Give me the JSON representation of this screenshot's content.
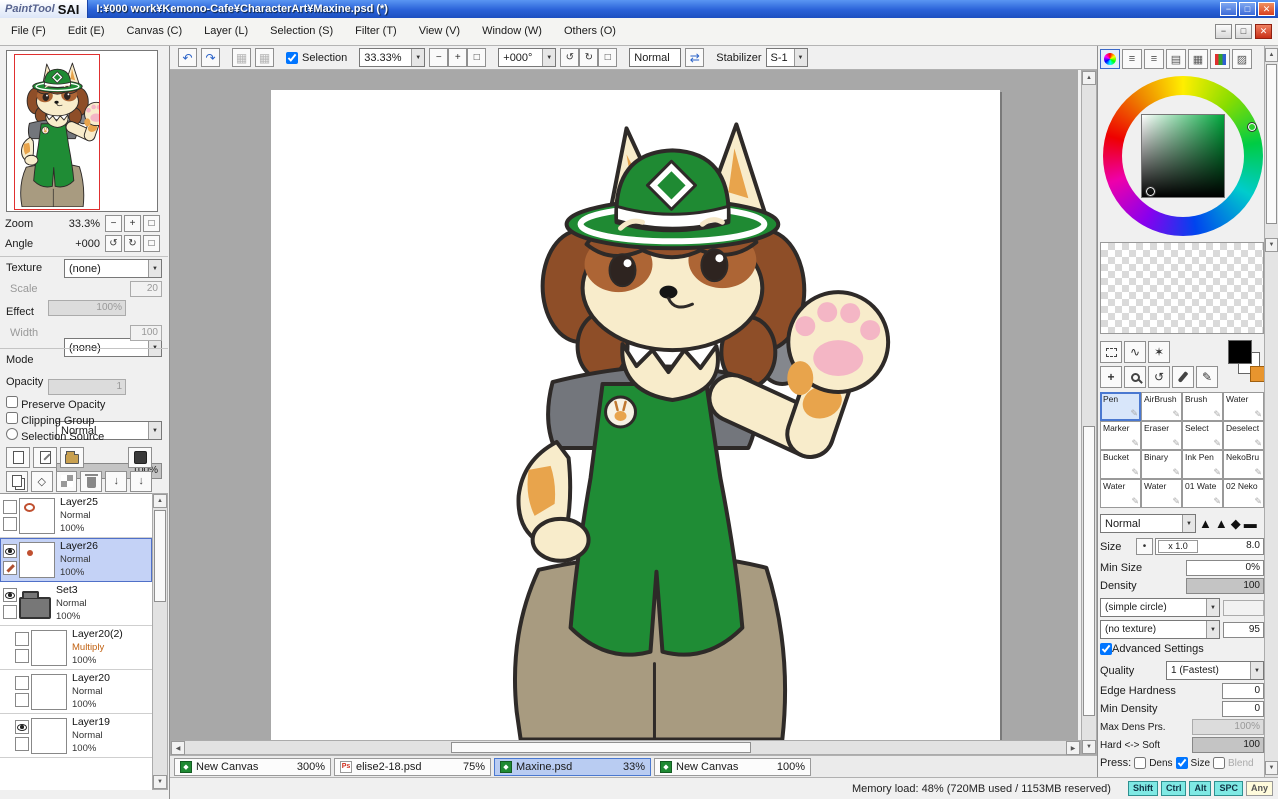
{
  "titlebar": {
    "logo_script": "PaintTool",
    "logo_bold": "SAI",
    "title": "I:¥000 work¥Kemono-Cafe¥CharacterArt¥Maxine.psd (*)"
  },
  "menubar": {
    "items": [
      {
        "label": "File (F)"
      },
      {
        "label": "Edit (E)"
      },
      {
        "label": "Canvas (C)"
      },
      {
        "label": "Layer (L)"
      },
      {
        "label": "Selection (S)"
      },
      {
        "label": "Filter (T)"
      },
      {
        "label": "View (V)"
      },
      {
        "label": "Window (W)"
      },
      {
        "label": "Others (O)"
      }
    ]
  },
  "toolbar": {
    "selection_checkbox_label": "Selection",
    "zoom_value": "33.33%",
    "angle_value": "+000°",
    "blend_value": "Normal",
    "stabilizer_label": "Stabilizer",
    "stabilizer_value": "S-1"
  },
  "navigator": {
    "zoom_label": "Zoom",
    "zoom_value": "33.3%",
    "angle_label": "Angle",
    "angle_value": "+000"
  },
  "layer_panel": {
    "texture_label": "Texture",
    "texture_value": "(none)",
    "texture_scale_label": "Scale",
    "texture_scale_value": "100%",
    "texture_strength_value": "20",
    "effect_label": "Effect",
    "effect_value": "(none)",
    "effect_width_label": "Width",
    "effect_width_value": "1",
    "effect_strength_value": "100",
    "mode_label": "Mode",
    "mode_value": "Normal",
    "opacity_label": "Opacity",
    "opacity_value": "100%",
    "preserve_opacity_label": "Preserve Opacity",
    "clipping_group_label": "Clipping Group",
    "selection_source_label": "Selection Source"
  },
  "layers": [
    {
      "name": "Layer25",
      "mode": "Normal",
      "opacity": "100%"
    },
    {
      "name": "Layer26",
      "mode": "Normal",
      "opacity": "100%"
    },
    {
      "name": "Set3",
      "mode": "Normal",
      "opacity": "100%"
    },
    {
      "name": "Layer20(2)",
      "mode": "Multiply",
      "opacity": "100%"
    },
    {
      "name": "Layer20",
      "mode": "Normal",
      "opacity": "100%"
    },
    {
      "name": "Layer19",
      "mode": "Normal",
      "opacity": "100%"
    }
  ],
  "tabs": [
    {
      "name": "New Canvas",
      "zoom": "300%"
    },
    {
      "name": "elise2-18.psd",
      "zoom": "75%"
    },
    {
      "name": "Maxine.psd",
      "zoom": "33%"
    },
    {
      "name": "New Canvas",
      "zoom": "100%"
    }
  ],
  "statusbar": {
    "memory": "Memory load: 48% (720MB used / 1153MB reserved)",
    "keys": [
      {
        "label": "Shift"
      },
      {
        "label": "Ctrl"
      },
      {
        "label": "Alt"
      },
      {
        "label": "SPC"
      },
      {
        "label": "Any"
      }
    ]
  },
  "tools": [
    {
      "name": "Pen"
    },
    {
      "name": "AirBrush"
    },
    {
      "name": "Brush"
    },
    {
      "name": "Water"
    },
    {
      "name": "Marker"
    },
    {
      "name": "Eraser"
    },
    {
      "name": "Select"
    },
    {
      "name": "Deselect"
    },
    {
      "name": "Bucket"
    },
    {
      "name": "Binary"
    },
    {
      "name": "Ink Pen"
    },
    {
      "name": "NekoBru"
    },
    {
      "name": "Water"
    },
    {
      "name": "Water"
    },
    {
      "name": "01 Wate"
    },
    {
      "name": "02 Neko"
    }
  ],
  "brush": {
    "blend_value": "Normal",
    "size_label": "Size",
    "size_unit": "x 1.0",
    "size_value": "8.0",
    "min_size_label": "Min Size",
    "min_size_value": "0%",
    "density_label": "Density",
    "density_value": "100",
    "shape_value": "(simple circle)",
    "shape_strength": "",
    "texture_value": "(no texture)",
    "texture_strength": "95",
    "advanced_label": "Advanced Settings",
    "quality_label": "Quality",
    "quality_value": "1 (Fastest)",
    "edge_hardness_label": "Edge Hardness",
    "edge_hardness_value": "0",
    "min_density_label": "Min Density",
    "min_density_value": "0",
    "max_dens_label": "Max Dens Prs.",
    "max_dens_value": "100%",
    "hard_soft_label": "Hard <-> Soft",
    "hard_soft_value": "100",
    "press_label": "Press:",
    "press_dens_label": "Dens",
    "press_size_label": "Size",
    "press_blend_label": "Blend"
  },
  "colors": {
    "accent_green": "#1F8A33",
    "selected_tab_bg": "#B9CCF2",
    "primary_color": "#000000",
    "secondary_color": "#FFFFFF",
    "tertiary_color": "#E8952E",
    "multiply_mode_text": "#C06010"
  },
  "icons": {
    "undo": "↶",
    "redo": "↷",
    "grid": "▦",
    "dropdown": "▼",
    "minus": "−",
    "plus": "+",
    "reset": "□",
    "rotate_ccw": "↺",
    "rotate_cw": "↻",
    "swap": "⇄",
    "up": "▲",
    "down": "▼",
    "left": "◀",
    "right": "▶",
    "lasso": "∿",
    "wand": "✶",
    "move": "+",
    "pen": "✎",
    "lines": "≡",
    "grid2": "▤",
    "grid3": "▨",
    "tip_triangle": "▲",
    "tip_tri2": "▲",
    "tip_diamond": "◆",
    "tip_bar": "▬",
    "diamond": "◇",
    "arrow_down": "↓",
    "dot": "•",
    "win_min": "−",
    "win_max": "□",
    "win_close": "✕",
    "canvas_icon_glyph": "◆",
    "psd_icon_glyph": "Ps"
  }
}
